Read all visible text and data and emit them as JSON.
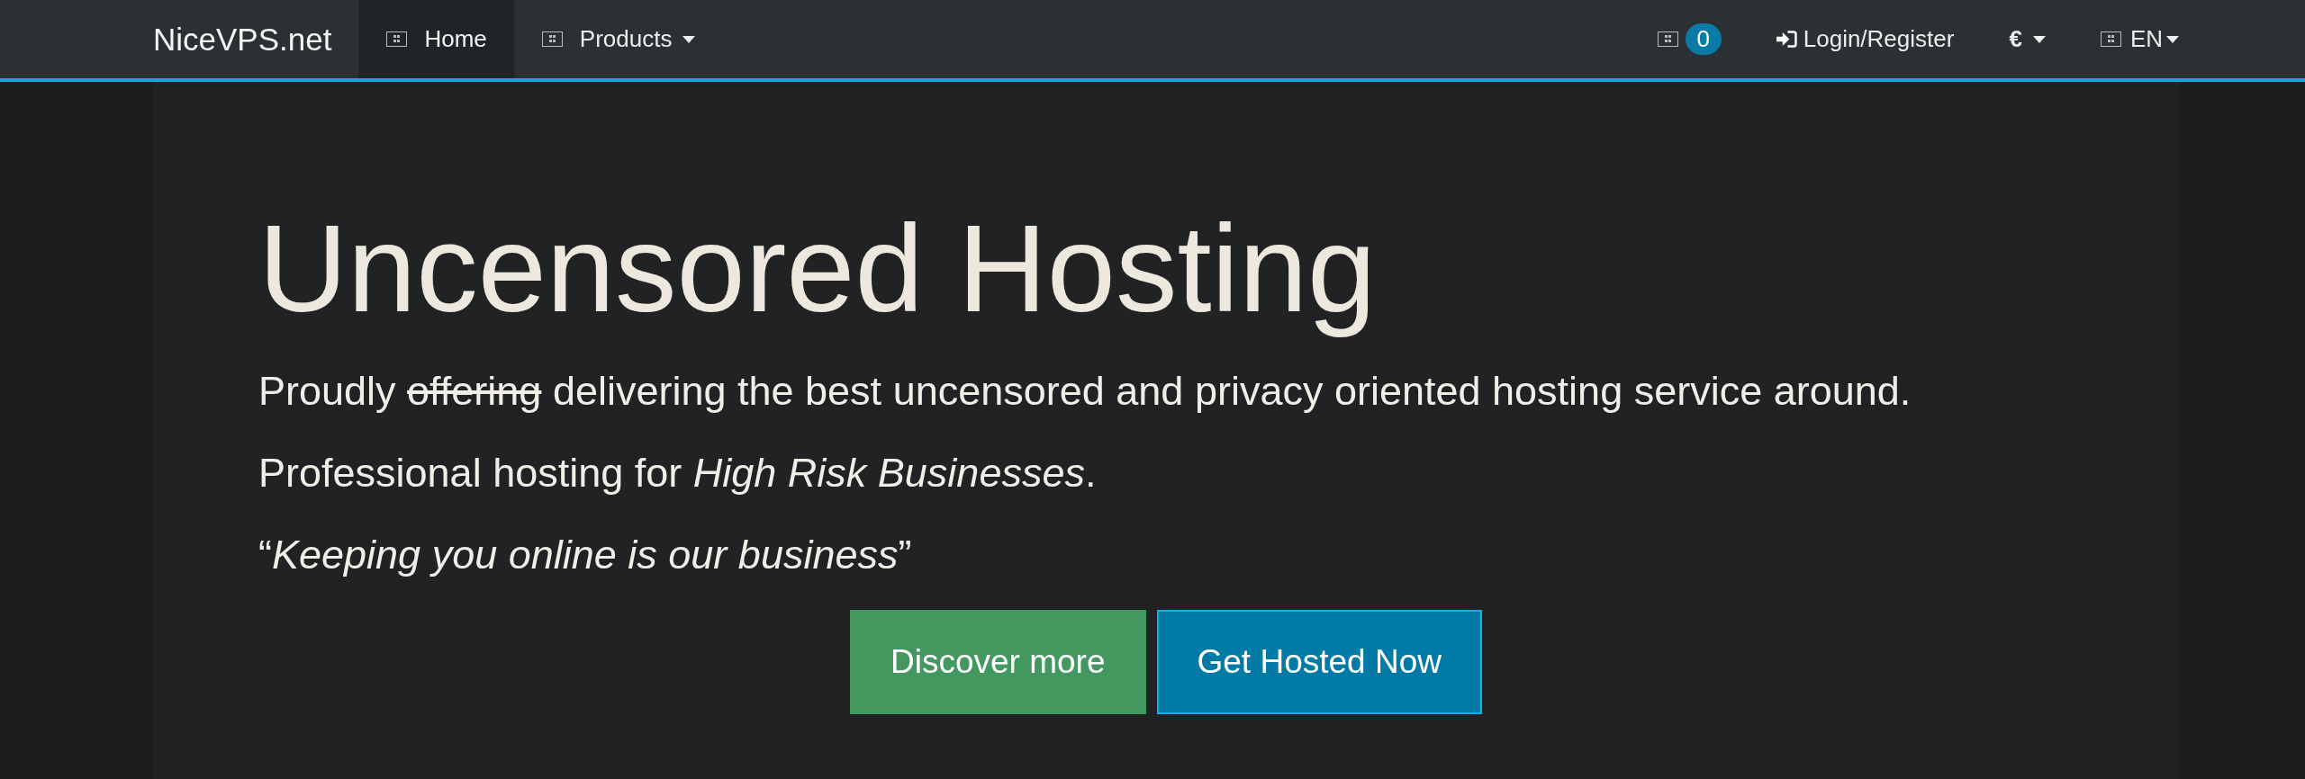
{
  "navbar": {
    "brand": "NiceVPS.net",
    "left_items": [
      {
        "label": "Home",
        "selected": true,
        "dropdown": false
      },
      {
        "label": "Products",
        "selected": false,
        "dropdown": true
      }
    ],
    "right_items": [
      {
        "kind": "cart",
        "count": "0",
        "dropdown": false
      },
      {
        "kind": "login",
        "label": "Login/Register",
        "dropdown": false
      },
      {
        "kind": "currency",
        "label": "€",
        "dropdown": true
      },
      {
        "kind": "language",
        "label": "EN",
        "dropdown": true
      }
    ]
  },
  "hero": {
    "title": "Uncensored Hosting",
    "lines": [
      {
        "segments": [
          {
            "text": "Proudly ",
            "struck": false
          },
          {
            "text": "offering",
            "struck": true
          },
          {
            "text": " delivering the best uncensored and privacy oriented hosting service around.",
            "struck": false
          }
        ]
      },
      {
        "segments": [
          {
            "text": "Professional hosting for *High Risk Businesses*.",
            "struck": false
          }
        ]
      },
      {
        "segments": [
          {
            "text": "“*Keeping you online is our business*”",
            "struck": false
          }
        ]
      }
    ],
    "buttons": [
      {
        "label": "Discover more",
        "kind": "success"
      },
      {
        "label": "Get Hosted Now",
        "kind": "primary"
      }
    ]
  }
}
